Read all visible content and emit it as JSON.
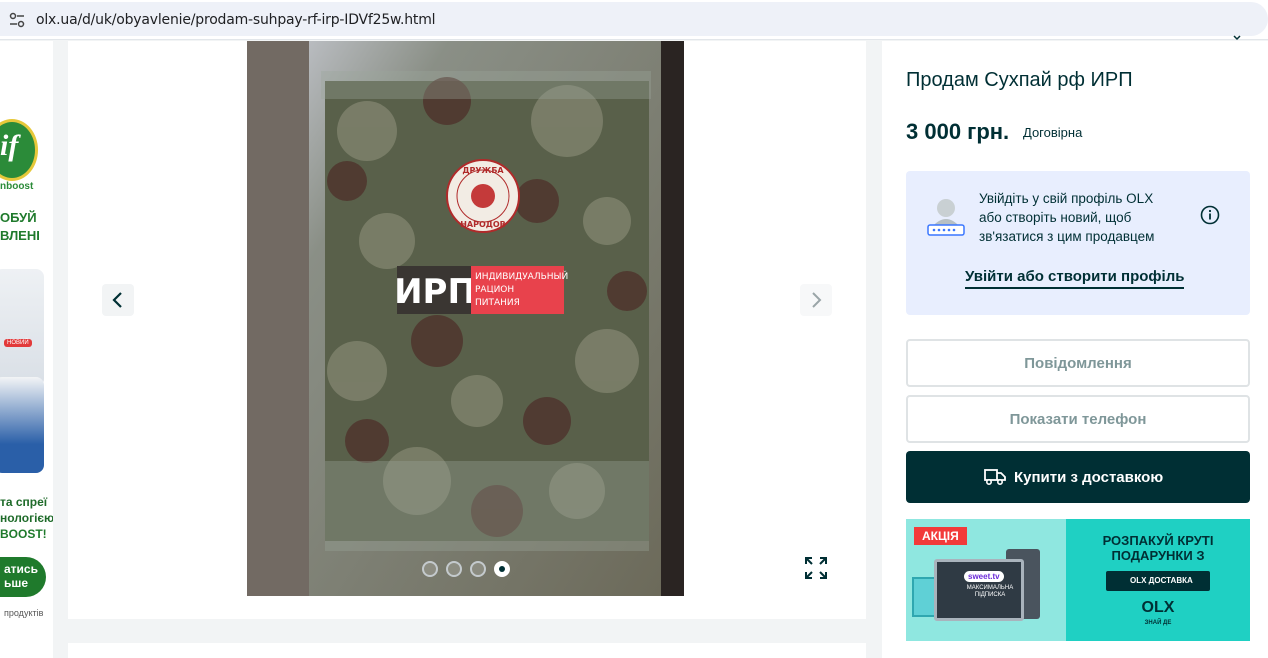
{
  "browser": {
    "url": "olx.ua/d/uk/obyavlenie/prodam-suhpay-rf-irp-IDVf25w.html",
    "site_info_icon": "tune-icon"
  },
  "left_ad": {
    "logo_text": "if",
    "logo_sub": "nboost",
    "line1": "ОБУЙ",
    "line2": "ВЛЕНІ",
    "badge": "НОВИЙ",
    "tag1": "та спреї",
    "tag2": "нологією",
    "tag3": "BOOST!",
    "cta_line1": "атись",
    "cta_line2": "ьше",
    "footer": "продуктів"
  },
  "gallery": {
    "photo_text": {
      "brand_top": "ДРУЖБА",
      "brand_bottom": "НАРОДОВ",
      "product_code": "ИРП",
      "product_line1": "ИНДИВИДУАЛЬНЫЙ",
      "product_line2": "РАЦИОН",
      "product_line3": "ПИТАНИЯ"
    },
    "total_images": 4,
    "active_image": 4,
    "prev_icon": "chevron-left-icon",
    "next_icon": "chevron-right-icon",
    "fullscreen_icon": "expand-icon"
  },
  "listing": {
    "title": "Продам Сухпай рф ИРП",
    "price": "3 000 грн.",
    "negotiable": "Договірна"
  },
  "login_prompt": {
    "message": "Увійдіть у свій профіль OLX або створіть новий, щоб зв'язатися з цим продавцем",
    "link": "Увійти або створити профіль",
    "info_icon": "info-icon",
    "avatar_icon": "user-password-icon"
  },
  "actions": {
    "message_label": "Повідомлення",
    "phone_label": "Показати телефон",
    "buy_label": "Купити з доставкою",
    "buy_icon": "truck-icon"
  },
  "promo": {
    "badge": "АКЦІЯ",
    "screen_brand": "sweet.tv",
    "screen_sub": "МАКСИМАЛЬНА ПІДПИСКА",
    "headline_line1": "РОЗПАКУЙ КРУТІ",
    "headline_line2": "ПОДАРУНКИ З",
    "delivery_label": "OLX ДОСТАВКА",
    "logo": "OLX",
    "slogan": "ЗНАЙ ДЕ"
  },
  "colors": {
    "brand_dark": "#002f34",
    "login_bg": "#e8eefe",
    "promo_teal": "#1fd0c3",
    "label_red": "#e8424c"
  }
}
